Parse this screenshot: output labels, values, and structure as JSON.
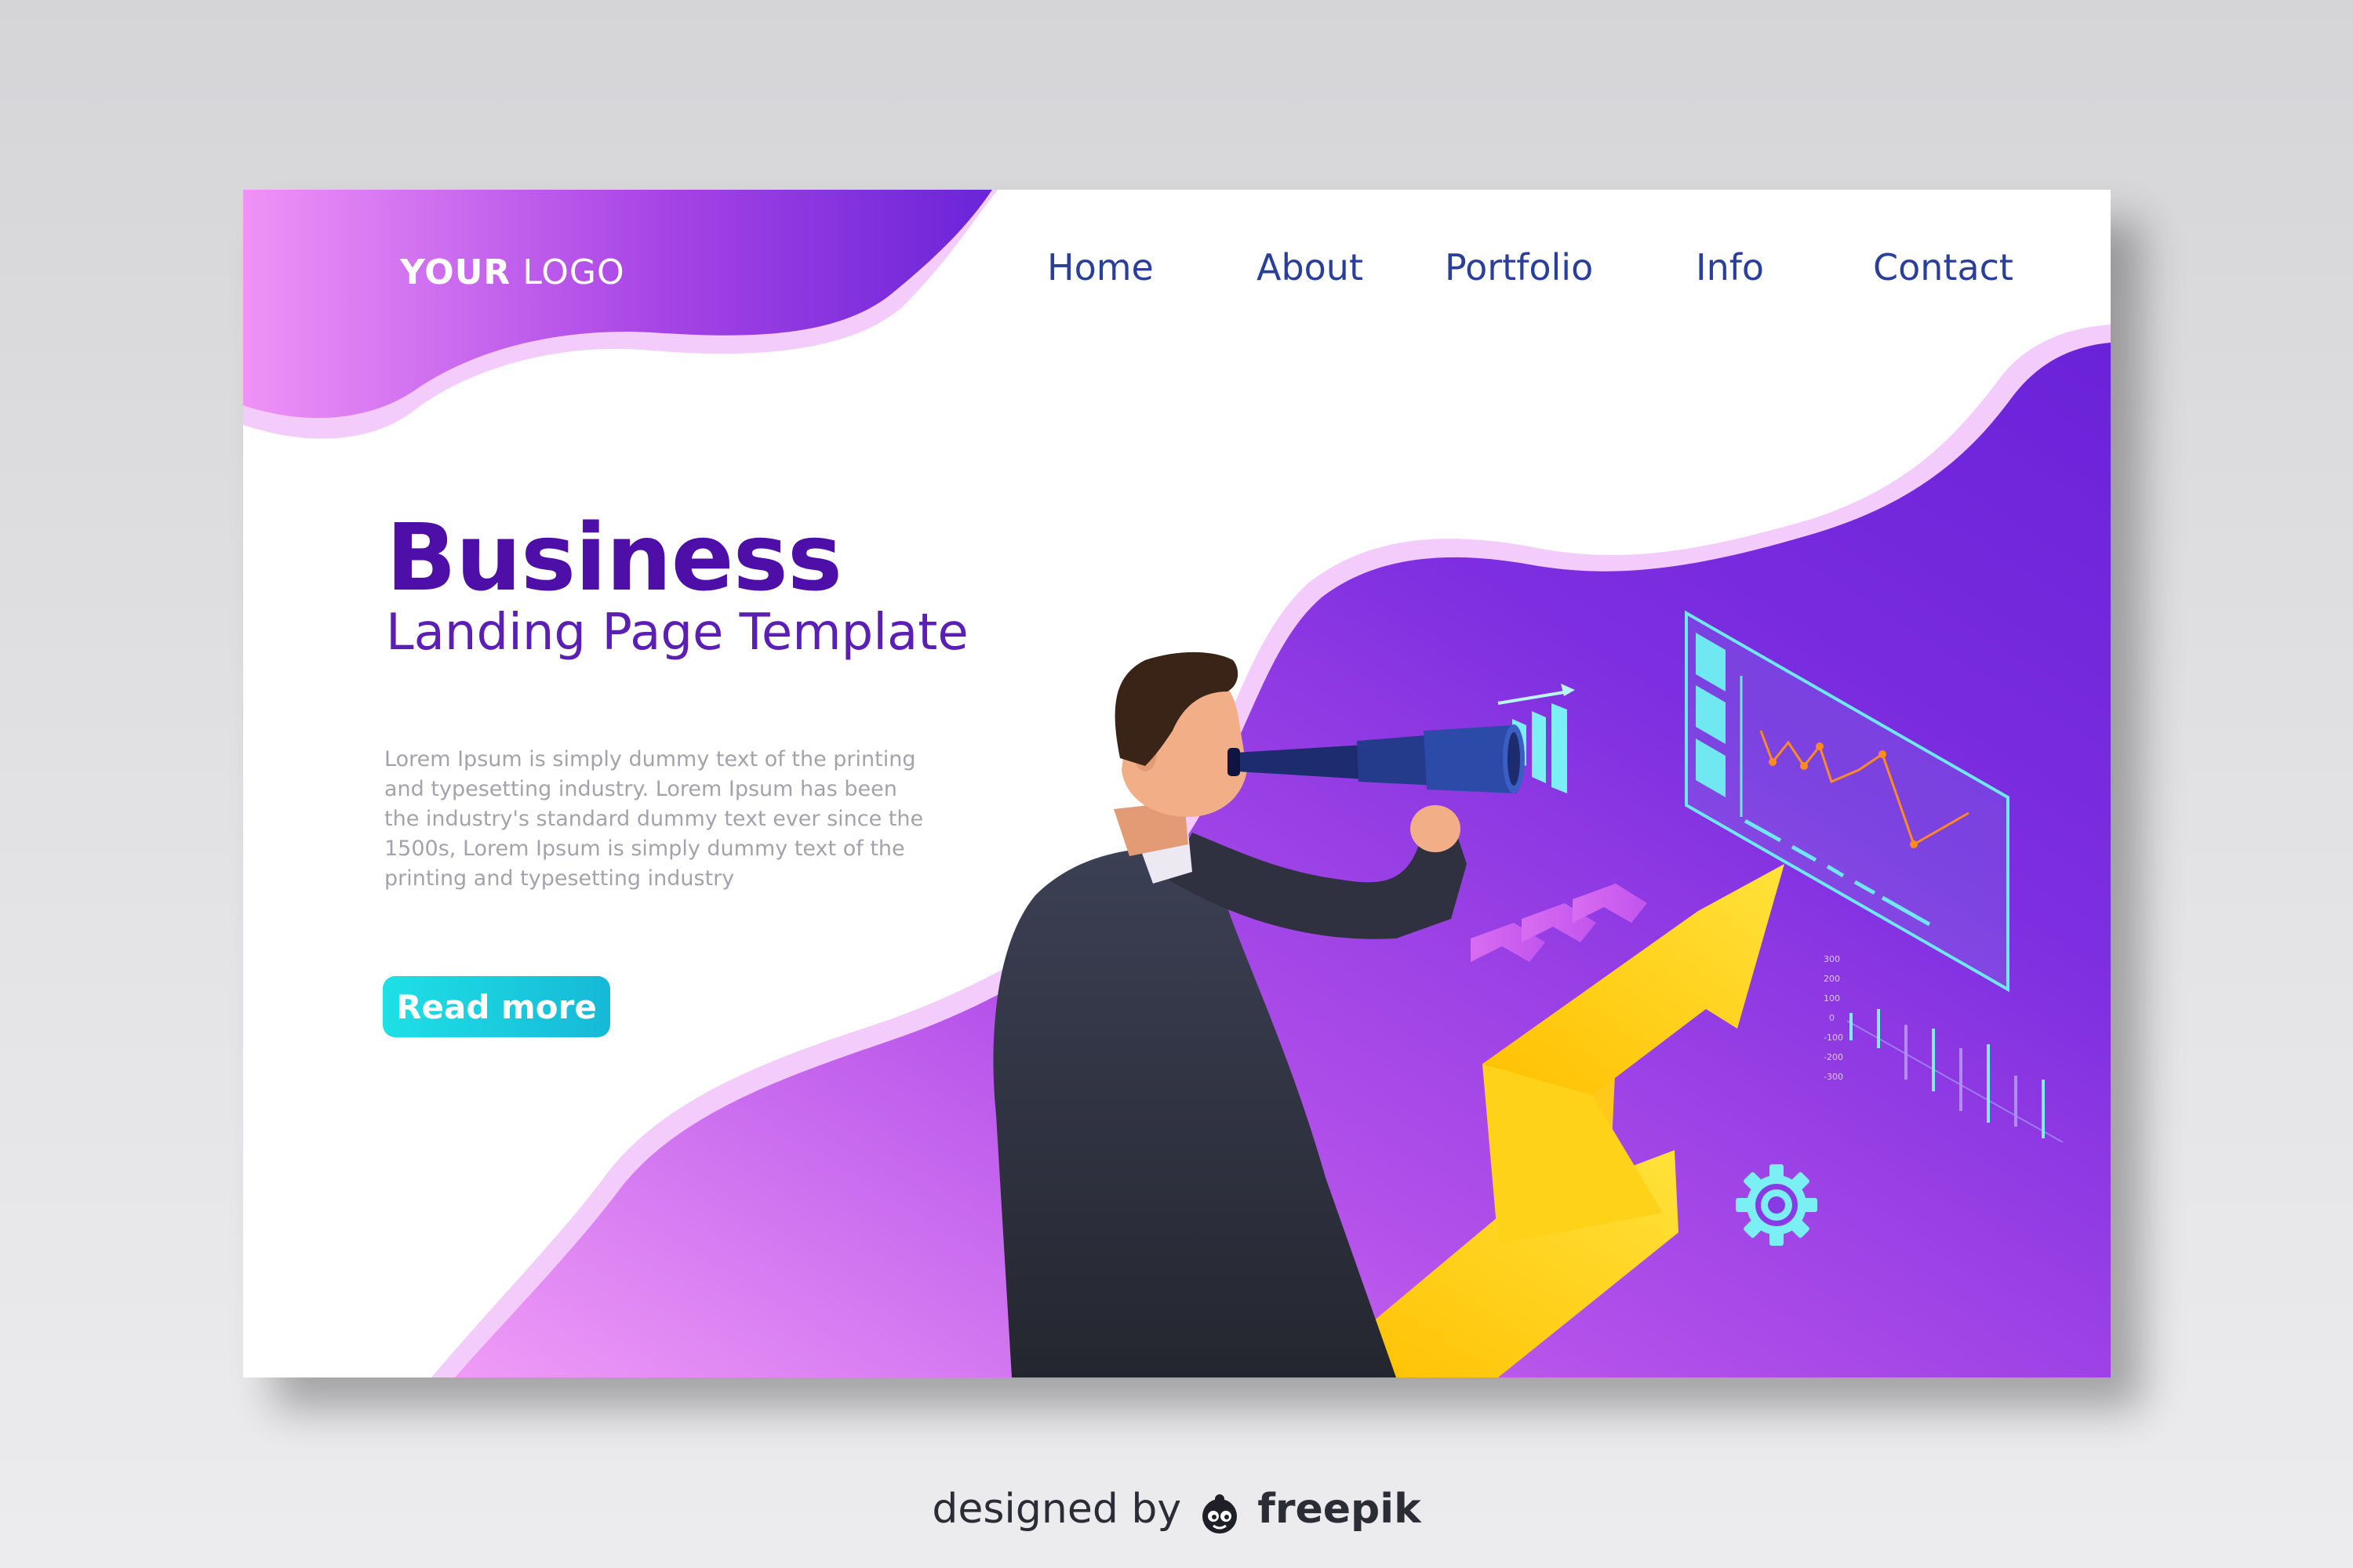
{
  "logo": {
    "bold": "YOUR",
    "regular": "LOGO"
  },
  "nav": {
    "items": [
      {
        "label": "Home"
      },
      {
        "label": "About"
      },
      {
        "label": "Portfolio"
      },
      {
        "label": "Info"
      },
      {
        "label": "Contact"
      }
    ]
  },
  "hero": {
    "title": "Business",
    "subtitle": "Landing Page Template",
    "body": "Lorem Ipsum is simply dummy text of the printing and typesetting industry. Lorem Ipsum has been the industry's standard dummy text ever since the 1500s, Lorem Ipsum is simply dummy text of the printing and typesetting industry",
    "button": "Read more"
  },
  "illustration": {
    "axis_ticks": [
      "300",
      "200",
      "100",
      "0",
      "-100",
      "-200",
      "-300"
    ]
  },
  "footer": {
    "prefix": "designed by",
    "brand": "freepik"
  },
  "colors": {
    "accent_purple": "#6a1ed8",
    "accent_pink": "#e58cf5",
    "nav_text": "#2a3f9a",
    "title": "#4d0fa8",
    "button": "#1ee0e6",
    "arrow_yellow": "#ffd21a",
    "panel_cyan": "#6fe8f2"
  },
  "icons": [
    "gear-icon",
    "bar-chart-icon",
    "trend-arrow-icon",
    "chevron-arrows-icon",
    "telescope-icon",
    "freepik-logo-icon"
  ]
}
